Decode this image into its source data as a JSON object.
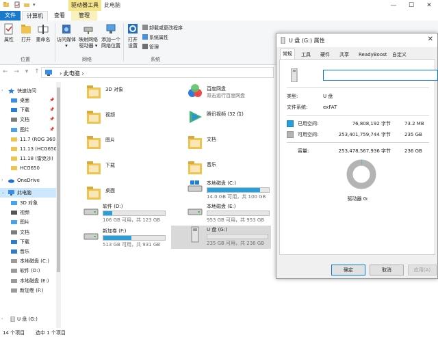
{
  "titlebar": {
    "tool_tab": "驱动器工具",
    "window_title": "此电脑",
    "controls": [
      "—",
      "☐",
      "✕"
    ]
  },
  "ribbon_tabs": {
    "file": "文件",
    "computer": "计算机",
    "view": "查看",
    "manage": "管理"
  },
  "ribbon": {
    "location_group": {
      "label": "位置",
      "properties": "属性",
      "open": "打开",
      "rename": "重命名"
    },
    "network_group": {
      "label": "网络",
      "access_media_1": "访问媒体",
      "access_media_2": "▾",
      "map_drive_1": "映射网络",
      "map_drive_2": "驱动器 ▾",
      "add_location_1": "添加一个",
      "add_location_2": "网络位置"
    },
    "system_group": {
      "label": "系统",
      "open_settings_1": "打开",
      "open_settings_2": "设置",
      "uninstall": "卸载或更改程序",
      "system_props": "系统属性",
      "manage": "管理"
    }
  },
  "addressbar": {
    "nav": "← → ▾ ↑",
    "path": "› 此电脑 ›"
  },
  "nav": {
    "quick_access": "快速访问",
    "items": [
      {
        "label": "桌面",
        "pinned": "📌"
      },
      {
        "label": "下载",
        "pinned": "📌"
      },
      {
        "label": "文档",
        "pinned": "📌"
      },
      {
        "label": "图片",
        "pinned": "📌"
      },
      {
        "label": "11.7 (ROG 360",
        "pinned": ""
      },
      {
        "label": "11.13 (HCG650",
        "pinned": ""
      },
      {
        "label": "11.18 (雷克沙)",
        "pinned": ""
      },
      {
        "label": "HCG650",
        "pinned": ""
      }
    ],
    "onedrive": "OneDrive",
    "this_pc": "此电脑",
    "pc_items": [
      "3D 对象",
      "视频",
      "图片",
      "文档",
      "下载",
      "音乐",
      "本地磁盘 (C:)",
      "软件 (D:)",
      "本地磁盘 (E:)",
      "新加卷 (F:)"
    ],
    "usb": "U 盘 (G:)"
  },
  "main": {
    "folders_left": [
      "3D 对象",
      "视频",
      "图片",
      "下载",
      "桌面"
    ],
    "folders_right": [
      {
        "name": "百度网盘",
        "sub": "双击运行百度网盘"
      },
      {
        "name": "腾讯视频 (32 位)",
        "sub": ""
      },
      {
        "name": "文档",
        "sub": ""
      },
      {
        "name": "音乐",
        "sub": ""
      }
    ],
    "drives": [
      {
        "name": "本地磁盘 (C:)",
        "sub": "14.0 GB 可用，共 100 GB",
        "used_fraction": 0.86
      },
      {
        "name": "软件 (D:)",
        "sub": "106 GB 可用，共 123 GB",
        "used_fraction": 0.14
      },
      {
        "name": "本地磁盘 (E:)",
        "sub": "953 GB 可用，共 953 GB",
        "used_fraction": 0.0
      },
      {
        "name": "新加卷 (F:)",
        "sub": "513 GB 可用，共 931 GB",
        "used_fraction": 0.45
      },
      {
        "name": "U 盘 (G:)",
        "sub": "235 GB 可用，共 236 GB",
        "used_fraction": 0.0
      }
    ]
  },
  "statusbar": {
    "count": "14 个项目",
    "selected": "选中 1 个项目"
  },
  "dialog": {
    "title": "U 盘 (G:) 属性",
    "close": "✕",
    "tabs": [
      "常规",
      "工具",
      "硬件",
      "共享",
      "ReadyBoost",
      "自定义"
    ],
    "volume_name": "",
    "type_label": "类型:",
    "type_value": "U 盘",
    "fs_label": "文件系统:",
    "fs_value": "exFAT",
    "used_label": "已用空间:",
    "used_bytes": "76,808,192 字节",
    "used_size": "73.2 MB",
    "free_label": "可用空间:",
    "free_bytes": "253,401,759,744 字节",
    "free_size": "235 GB",
    "cap_label": "容量:",
    "cap_bytes": "253,478,567,936 字节",
    "cap_size": "236 GB",
    "drive_label": "驱动器 G:",
    "used_fraction": 0.0003,
    "used_color": "#26a0da",
    "free_color": "#b4b4b4",
    "ok": "确定",
    "cancel": "取消",
    "apply": "应用(A)"
  }
}
